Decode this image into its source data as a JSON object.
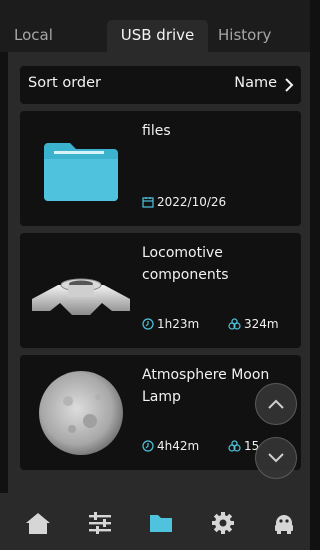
{
  "tabs": [
    {
      "label": "Local"
    },
    {
      "label": "USB drive"
    },
    {
      "label": "History"
    }
  ],
  "sort": {
    "label": "Sort order",
    "value": "Name"
  },
  "items": [
    {
      "title": "files",
      "date": "2022/10/26",
      "thumb_icon": "folder-icon"
    },
    {
      "title": "Locomotive components",
      "time": "1h23m",
      "weight": "324m",
      "thumb_icon": "mechanical-part-thumbnail"
    },
    {
      "title": "Atmosphere Moon Lamp",
      "time": "4h42m",
      "weight": "15",
      "thumb_icon": "moon-sphere-thumbnail"
    }
  ],
  "nav": [
    {
      "name": "home-icon"
    },
    {
      "name": "sliders-icon"
    },
    {
      "name": "folder-icon",
      "active": true
    },
    {
      "name": "gear-icon"
    },
    {
      "name": "robot-icon"
    }
  ],
  "colors": {
    "accent": "#4fc3dd",
    "active_tab_bg": "#2a2a2a",
    "card_bg": "#111111"
  }
}
